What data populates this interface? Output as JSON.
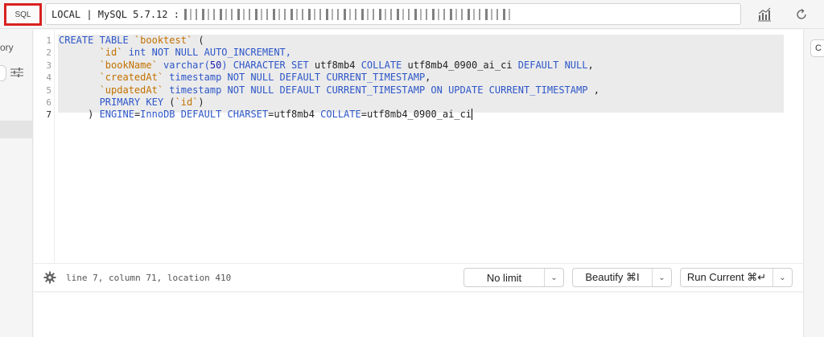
{
  "topbar": {
    "badge": "SQL",
    "connection": "LOCAL | MySQL 5.7.12 :",
    "icons": [
      "chart-icon",
      "refresh-icon"
    ]
  },
  "sidebar": {
    "partial_label": "ory"
  },
  "editor": {
    "line_numbers": [
      "1",
      "2",
      "3",
      "4",
      "5",
      "6",
      "7"
    ],
    "lines": [
      [
        {
          "t": "CREATE TABLE ",
          "c": "kw"
        },
        {
          "t": "`booktest`",
          "c": "bt"
        },
        {
          "t": " (",
          "c": ""
        }
      ],
      [
        {
          "t": "       ",
          "c": ""
        },
        {
          "t": "`id`",
          "c": "bt"
        },
        {
          "t": " int NOT NULL AUTO_INCREMENT,",
          "c": "kw"
        }
      ],
      [
        {
          "t": "       ",
          "c": ""
        },
        {
          "t": "`bookName`",
          "c": "bt"
        },
        {
          "t": " varchar(",
          "c": "kw"
        },
        {
          "t": "50",
          "c": "num"
        },
        {
          "t": ") CHARACTER SET ",
          "c": "kw"
        },
        {
          "t": "utf8mb4 ",
          "c": ""
        },
        {
          "t": "COLLATE ",
          "c": "kw"
        },
        {
          "t": "utf8mb4_0900_ai_ci ",
          "c": ""
        },
        {
          "t": "DEFAULT NULL",
          "c": "kw"
        },
        {
          "t": ",",
          "c": ""
        }
      ],
      [
        {
          "t": "       ",
          "c": ""
        },
        {
          "t": "`createdAt`",
          "c": "bt"
        },
        {
          "t": " timestamp NOT NULL DEFAULT CURRENT_TIMESTAMP",
          "c": "kw"
        },
        {
          "t": ",",
          "c": ""
        }
      ],
      [
        {
          "t": "       ",
          "c": ""
        },
        {
          "t": "`updatedAt`",
          "c": "bt"
        },
        {
          "t": " timestamp NOT NULL DEFAULT CURRENT_TIMESTAMP ON UPDATE CURRENT_TIMESTAMP",
          "c": "kw"
        },
        {
          "t": " ,",
          "c": ""
        }
      ],
      [
        {
          "t": "       ",
          "c": ""
        },
        {
          "t": "PRIMARY KEY ",
          "c": "kw"
        },
        {
          "t": "(",
          "c": ""
        },
        {
          "t": "`id`",
          "c": "bt"
        },
        {
          "t": ")",
          "c": ""
        }
      ],
      [
        {
          "t": "     ) ",
          "c": ""
        },
        {
          "t": "ENGINE",
          "c": "kw"
        },
        {
          "t": "=",
          "c": ""
        },
        {
          "t": "InnoDB DEFAULT CHARSET",
          "c": "kw"
        },
        {
          "t": "=",
          "c": ""
        },
        {
          "t": "utf8mb4 ",
          "c": ""
        },
        {
          "t": "COLLATE",
          "c": "kw"
        },
        {
          "t": "=",
          "c": ""
        },
        {
          "t": "utf8mb4_0900_ai_ci",
          "c": ""
        }
      ]
    ],
    "active_line": 7
  },
  "statusbar": {
    "position": "line 7, column 71, location 410",
    "limit_label": "No limit",
    "beautify_label": "Beautify ⌘I",
    "run_label": "Run Current ⌘↵"
  },
  "right": {
    "partial_label": "C"
  }
}
